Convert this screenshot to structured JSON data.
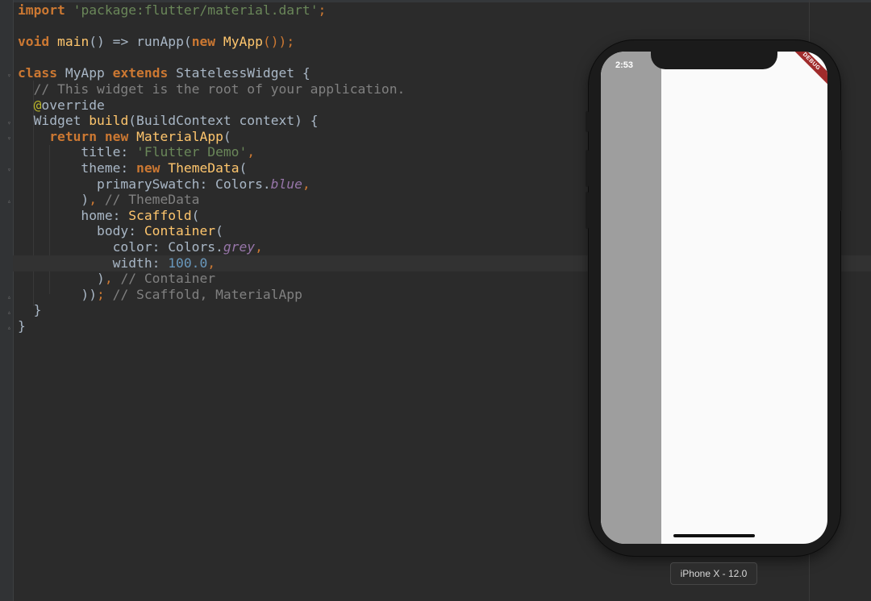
{
  "editor": {
    "lines": [
      {
        "segs": [
          {
            "t": "import",
            "c": "kw"
          },
          {
            "t": " ",
            "c": "pl"
          },
          {
            "t": "'package:flutter/material.dart'",
            "c": "str"
          },
          {
            "t": ";",
            "c": "kw-n"
          }
        ]
      },
      {
        "segs": []
      },
      {
        "segs": [
          {
            "t": "void",
            "c": "kw"
          },
          {
            "t": " ",
            "c": "pl"
          },
          {
            "t": "main",
            "c": "fn"
          },
          {
            "t": "() => runApp(",
            "c": "pl"
          },
          {
            "t": "new",
            "c": "kw"
          },
          {
            "t": " ",
            "c": "pl"
          },
          {
            "t": "MyApp",
            "c": "fn"
          },
          {
            "t": "());",
            "c": "kw-n"
          }
        ]
      },
      {
        "segs": []
      },
      {
        "segs": [
          {
            "t": "class",
            "c": "kw"
          },
          {
            "t": " MyApp ",
            "c": "pl"
          },
          {
            "t": "extends",
            "c": "kw"
          },
          {
            "t": " StatelessWidget {",
            "c": "pl"
          }
        ]
      },
      {
        "segs": [
          {
            "t": "  // This widget is the root of your application.",
            "c": "cm"
          }
        ]
      },
      {
        "segs": [
          {
            "t": "  ",
            "c": "pl"
          },
          {
            "t": "@",
            "c": "ann"
          },
          {
            "t": "override",
            "c": "pl"
          }
        ]
      },
      {
        "segs": [
          {
            "t": "  Widget ",
            "c": "pl"
          },
          {
            "t": "build",
            "c": "fn"
          },
          {
            "t": "(BuildContext context) {",
            "c": "pl"
          }
        ]
      },
      {
        "segs": [
          {
            "t": "    ",
            "c": "pl"
          },
          {
            "t": "return",
            "c": "kw"
          },
          {
            "t": " ",
            "c": "pl"
          },
          {
            "t": "new",
            "c": "kw"
          },
          {
            "t": " ",
            "c": "pl"
          },
          {
            "t": "MaterialApp",
            "c": "fn"
          },
          {
            "t": "(",
            "c": "pl"
          }
        ]
      },
      {
        "segs": [
          {
            "t": "        title: ",
            "c": "pl"
          },
          {
            "t": "'Flutter Demo'",
            "c": "str"
          },
          {
            "t": ",",
            "c": "kw-n"
          }
        ]
      },
      {
        "segs": [
          {
            "t": "        theme: ",
            "c": "pl"
          },
          {
            "t": "new",
            "c": "kw"
          },
          {
            "t": " ",
            "c": "pl"
          },
          {
            "t": "ThemeData",
            "c": "fn"
          },
          {
            "t": "(",
            "c": "pl"
          }
        ]
      },
      {
        "segs": [
          {
            "t": "          primarySwatch: Colors.",
            "c": "pl"
          },
          {
            "t": "blue",
            "c": "it"
          },
          {
            "t": ",",
            "c": "kw-n"
          }
        ]
      },
      {
        "segs": [
          {
            "t": "        )",
            "c": "pl"
          },
          {
            "t": ",",
            "c": "kw-n"
          },
          {
            "t": " // ThemeData",
            "c": "cm"
          }
        ]
      },
      {
        "segs": [
          {
            "t": "        home: ",
            "c": "pl"
          },
          {
            "t": "Scaffold",
            "c": "fn"
          },
          {
            "t": "(",
            "c": "pl"
          }
        ]
      },
      {
        "segs": [
          {
            "t": "          body: ",
            "c": "pl"
          },
          {
            "t": "Container",
            "c": "fn"
          },
          {
            "t": "(",
            "c": "pl"
          }
        ]
      },
      {
        "segs": [
          {
            "t": "            color: Colors.",
            "c": "pl"
          },
          {
            "t": "grey",
            "c": "it"
          },
          {
            "t": ",",
            "c": "kw-n"
          }
        ]
      },
      {
        "segs": [
          {
            "t": "            width: ",
            "c": "pl"
          },
          {
            "t": "100.0",
            "c": "num"
          },
          {
            "t": ",",
            "c": "kw-n"
          }
        ]
      },
      {
        "segs": [
          {
            "t": "          )",
            "c": "pl"
          },
          {
            "t": ",",
            "c": "kw-n"
          },
          {
            "t": " // Container",
            "c": "cm"
          }
        ]
      },
      {
        "segs": [
          {
            "t": "        ))",
            "c": "pl"
          },
          {
            "t": ";",
            "c": "kw-n"
          },
          {
            "t": " // Scaffold, MaterialApp",
            "c": "cm"
          }
        ]
      },
      {
        "segs": [
          {
            "t": "  }",
            "c": "pl"
          }
        ]
      },
      {
        "segs": [
          {
            "t": "}",
            "c": "pl"
          }
        ]
      }
    ]
  },
  "simulator": {
    "status_time": "2:53",
    "debug_banner": "DEBUG",
    "device_label": "iPhone X - 12.0",
    "container_color": "#9e9e9e",
    "screen_bg": "#fafafa"
  },
  "colors": {
    "editor_bg": "#2b2b2b",
    "keyword": "#cc7832",
    "string": "#6a8759",
    "comment": "#808080",
    "function": "#ffc66d",
    "number": "#6897bb",
    "constant": "#9876aa",
    "debug_banner": "#a02b2b"
  }
}
